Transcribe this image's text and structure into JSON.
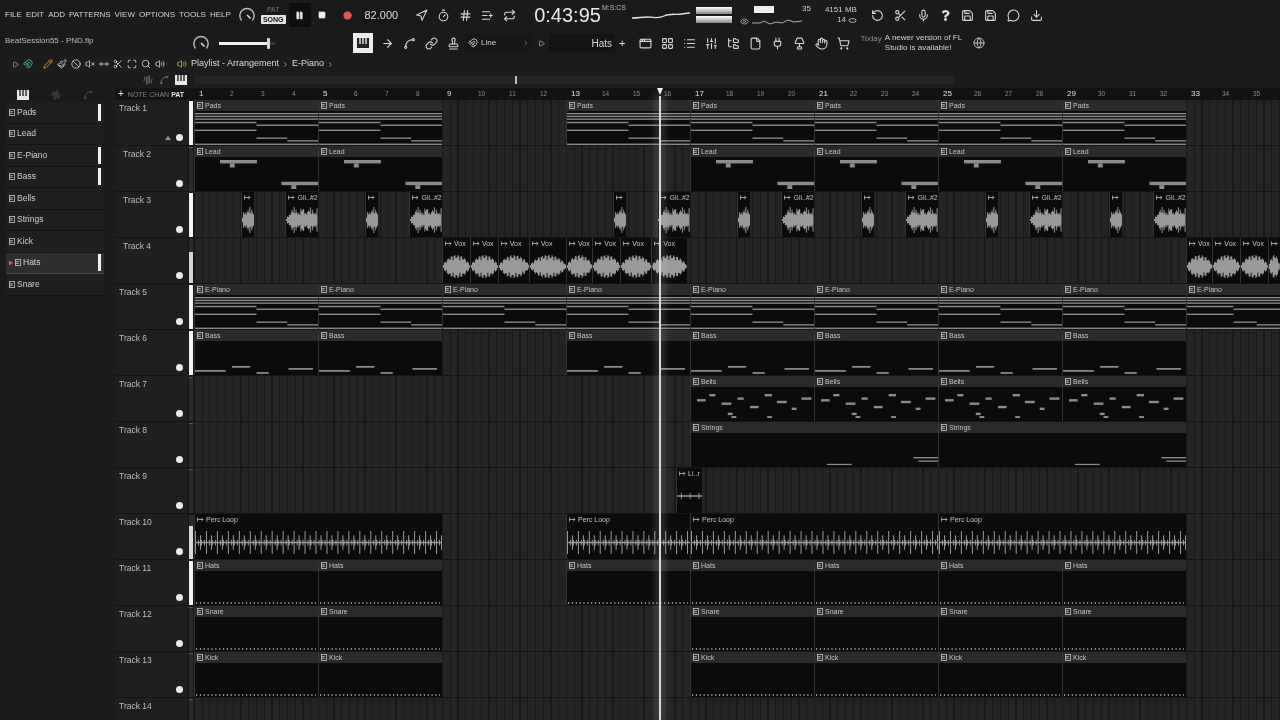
{
  "menu": [
    "FILE",
    "EDIT",
    "ADD",
    "PATTERNS",
    "VIEW",
    "OPTIONS",
    "TOOLS",
    "HELP"
  ],
  "transport": {
    "modes": [
      {
        "label": "PAT",
        "selected": false
      },
      {
        "label": "SONG",
        "selected": true
      }
    ],
    "tempo": "82.000"
  },
  "clock": {
    "time": "0:43:95",
    "unit": "M:S:CS"
  },
  "monitor": {
    "cpu": "35",
    "memory": "4151 MB",
    "voices": "14"
  },
  "project": {
    "file": "BeatSession55 - PND.flp"
  },
  "master_volume": {
    "level": 0.88
  },
  "snap": {
    "value": "Line"
  },
  "pattern_select": {
    "value": "Hats",
    "add": "+"
  },
  "news": {
    "date": "Today",
    "message": "A newer version of FL Studio is available!"
  },
  "playlist_toolbar": {
    "breadcrumb": [
      "Playlist - Arrangement",
      "E-Piano"
    ]
  },
  "pattern_picker": [
    {
      "label": "Pads",
      "selected": false,
      "marked": true
    },
    {
      "label": "Lead",
      "selected": false,
      "marked": false
    },
    {
      "label": "E-Piano",
      "selected": false,
      "marked": true
    },
    {
      "label": "Bass",
      "selected": false,
      "marked": true
    },
    {
      "label": "Bells",
      "selected": false,
      "marked": false
    },
    {
      "label": "Strings",
      "selected": false,
      "marked": false
    },
    {
      "label": "Kick",
      "selected": false,
      "marked": false
    },
    {
      "label": "Hats",
      "selected": true,
      "marked": true
    },
    {
      "label": "Snare",
      "selected": false,
      "marked": false
    }
  ],
  "playlist": {
    "view_modes": [
      {
        "label": "NOTE",
        "selected": false
      },
      {
        "label": "CHAN",
        "selected": false
      },
      {
        "label": "PAT",
        "selected": true
      }
    ],
    "add": "+",
    "ruler": [
      "1",
      "2",
      "3",
      "4",
      "5",
      "6",
      "7",
      "8",
      "9",
      "10",
      "11",
      "12",
      "13",
      "14",
      "15",
      "16",
      "17",
      "18",
      "19",
      "20",
      "21",
      "22",
      "23",
      "24",
      "25",
      "26",
      "27",
      "28",
      "29",
      "30",
      "31",
      "32",
      "33",
      "34",
      "35"
    ],
    "playhead": {
      "level": 0.429
    },
    "tracks": [
      {
        "name": "Track 1",
        "level": 1,
        "expanded": true,
        "clips": [
          {
            "kind": "pattern",
            "label": "Pads"
          },
          {
            "kind": "pattern",
            "label": "Pads"
          },
          {
            "kind": "pattern",
            "label": "Pads"
          },
          {
            "kind": "pattern",
            "label": "Pads"
          },
          {
            "kind": "pattern",
            "label": "Pads"
          },
          {
            "kind": "pattern",
            "label": "Pads"
          },
          {
            "kind": "pattern",
            "label": "Pads"
          }
        ],
        "children": [
          {
            "name": "Track 2",
            "level": 0,
            "clips": [
              {
                "kind": "pattern",
                "label": "Lead"
              },
              {
                "kind": "pattern",
                "label": "Lead"
              },
              {
                "kind": "pattern",
                "label": "Lead"
              },
              {
                "kind": "pattern",
                "label": "Lead"
              },
              {
                "kind": "pattern",
                "label": "Lead"
              },
              {
                "kind": "pattern",
                "label": "Lead"
              }
            ]
          },
          {
            "name": "Track 3",
            "level": 1,
            "clips": [
              {
                "kind": "audio"
              },
              {
                "kind": "audio",
                "label": "Gli..#2"
              },
              {
                "kind": "audio"
              },
              {
                "kind": "audio",
                "label": "Gli..#2"
              },
              {
                "kind": "audio"
              },
              {
                "kind": "audio",
                "label": "Gli..#2"
              },
              {
                "kind": "audio"
              },
              {
                "kind": "audio",
                "label": "Gli..#2"
              },
              {
                "kind": "audio"
              },
              {
                "kind": "audio",
                "label": "Gli..#2"
              },
              {
                "kind": "audio"
              },
              {
                "kind": "audio",
                "label": "Gli..#2"
              },
              {
                "kind": "audio"
              },
              {
                "kind": "audio",
                "label": "Gli..#2"
              }
            ]
          },
          {
            "name": "Track 4",
            "level": 0.7,
            "clips": [
              {
                "kind": "audio",
                "label": "Vox"
              },
              {
                "kind": "audio",
                "label": "Vox"
              },
              {
                "kind": "audio",
                "label": "Vox"
              },
              {
                "kind": "audio",
                "label": "Vox"
              },
              {
                "kind": "audio",
                "label": "Vox"
              },
              {
                "kind": "audio",
                "label": "Vox"
              },
              {
                "kind": "audio",
                "label": "Vox"
              },
              {
                "kind": "audio",
                "label": "Vox"
              },
              {
                "kind": "audio",
                "label": "Vox"
              },
              {
                "kind": "audio",
                "label": "Vox"
              },
              {
                "kind": "audio",
                "label": "Vox"
              },
              {
                "kind": "audio"
              }
            ]
          }
        ]
      },
      {
        "name": "Track 5",
        "level": 1,
        "clips": [
          {
            "kind": "pattern",
            "label": "E-Piano"
          },
          {
            "kind": "pattern",
            "label": "E-Piano"
          },
          {
            "kind": "pattern",
            "label": "E-Piano"
          },
          {
            "kind": "pattern",
            "label": "E-Piano"
          },
          {
            "kind": "pattern",
            "label": "E-Piano"
          },
          {
            "kind": "pattern",
            "label": "E-Piano"
          },
          {
            "kind": "pattern",
            "label": "E-Piano"
          },
          {
            "kind": "pattern",
            "label": "E-Piano"
          },
          {
            "kind": "pattern",
            "label": "E-Piano"
          }
        ]
      },
      {
        "name": "Track 6",
        "level": 1,
        "clips": [
          {
            "kind": "pattern",
            "label": "Bass"
          },
          {
            "kind": "pattern",
            "label": "Bass"
          },
          {
            "kind": "pattern",
            "label": "Bass"
          },
          {
            "kind": "pattern",
            "label": "Bass"
          },
          {
            "kind": "pattern",
            "label": "Bass"
          },
          {
            "kind": "pattern",
            "label": "Bass"
          },
          {
            "kind": "pattern",
            "label": "Bass"
          }
        ]
      },
      {
        "name": "Track 7",
        "level": 0,
        "clips": [
          {
            "kind": "pattern",
            "label": "Bells"
          },
          {
            "kind": "pattern",
            "label": "Bells"
          },
          {
            "kind": "pattern",
            "label": "Bells"
          },
          {
            "kind": "pattern",
            "label": "Bells"
          }
        ]
      },
      {
        "name": "Track 8",
        "level": 0,
        "clips": [
          {
            "kind": "pattern",
            "label": "Strings"
          },
          {
            "kind": "pattern",
            "label": "Strings"
          }
        ]
      },
      {
        "name": "Track 9",
        "level": 0,
        "clips": [
          {
            "kind": "audio",
            "label": "Li..r"
          }
        ]
      },
      {
        "name": "Track 10",
        "level": 0.75,
        "clips": [
          {
            "kind": "audio",
            "label": "Perc Loop"
          },
          {
            "kind": "audio",
            "label": "Perc Loop"
          },
          {
            "kind": "audio",
            "label": "Perc Loop"
          },
          {
            "kind": "audio",
            "label": "Perc Loop"
          }
        ]
      },
      {
        "name": "Track 11",
        "level": 1,
        "clips": [
          {
            "kind": "pattern",
            "label": "Hats"
          },
          {
            "kind": "pattern",
            "label": "Hats"
          },
          {
            "kind": "pattern",
            "label": "Hats"
          },
          {
            "kind": "pattern",
            "label": "Hats"
          },
          {
            "kind": "pattern",
            "label": "Hats"
          },
          {
            "kind": "pattern",
            "label": "Hats"
          },
          {
            "kind": "pattern",
            "label": "Hats"
          }
        ]
      },
      {
        "name": "Track 12",
        "level": 0,
        "clips": [
          {
            "kind": "pattern",
            "label": "Snare"
          },
          {
            "kind": "pattern",
            "label": "Snare"
          },
          {
            "kind": "pattern",
            "label": "Snare"
          },
          {
            "kind": "pattern",
            "label": "Snare"
          },
          {
            "kind": "pattern",
            "label": "Snare"
          },
          {
            "kind": "pattern",
            "label": "Snare"
          }
        ]
      },
      {
        "name": "Track 13",
        "level": 0,
        "clips": [
          {
            "kind": "pattern",
            "label": "Kick"
          },
          {
            "kind": "pattern",
            "label": "Kick"
          },
          {
            "kind": "pattern",
            "label": "Kick"
          },
          {
            "kind": "pattern",
            "label": "Kick"
          },
          {
            "kind": "pattern",
            "label": "Kick"
          },
          {
            "kind": "pattern",
            "label": "Kick"
          }
        ]
      },
      {
        "name": "Track 14",
        "level": 0
      }
    ]
  }
}
